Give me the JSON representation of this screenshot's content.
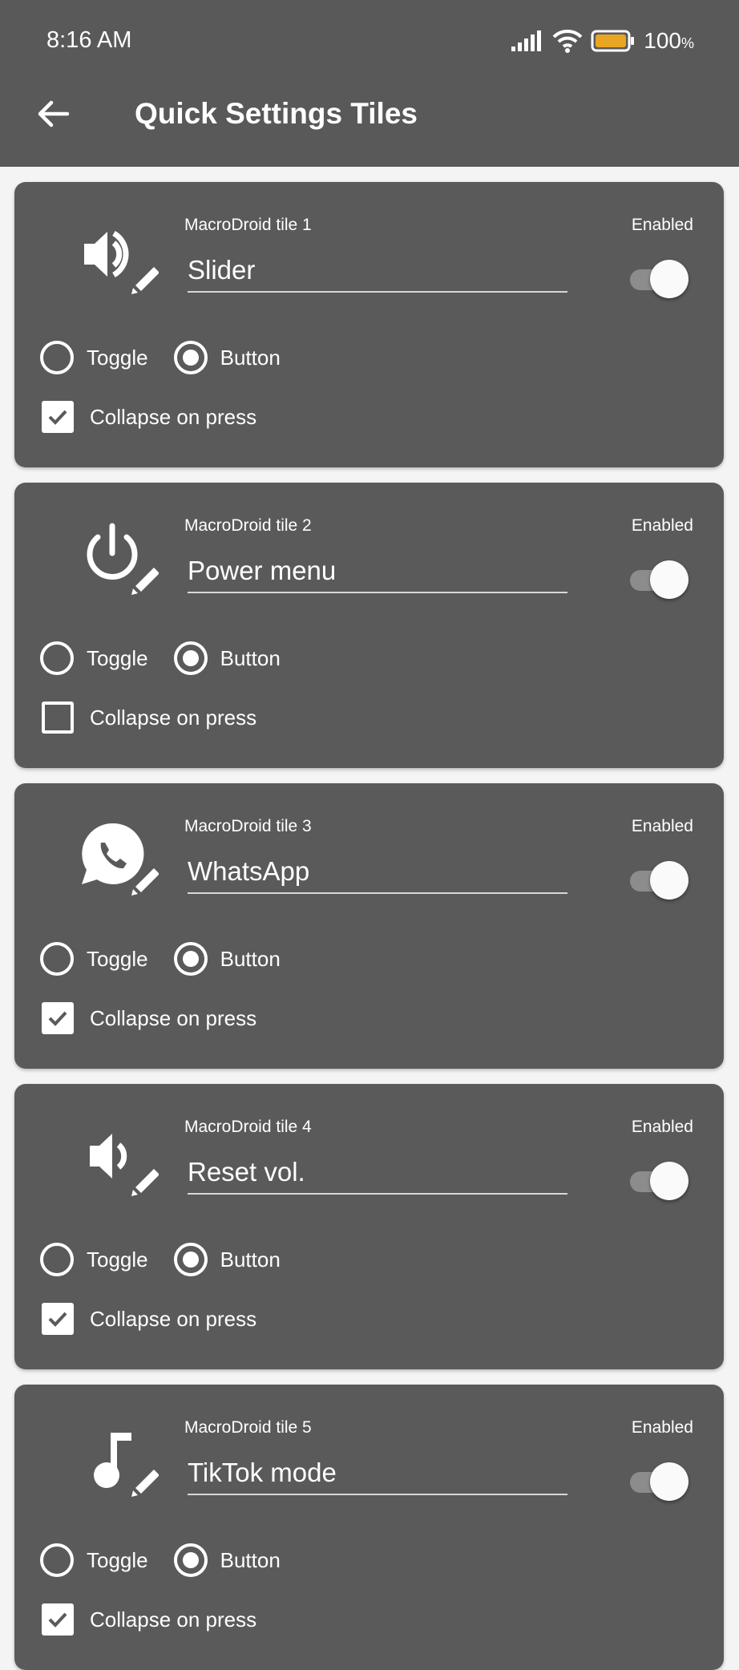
{
  "status_bar": {
    "time": "8:16 AM",
    "battery": "100",
    "battery_unit": "%"
  },
  "app_bar": {
    "title": "Quick Settings Tiles"
  },
  "tiles": [
    {
      "name": "MacroDroid tile 1",
      "label": "Slider",
      "enabled_label": "Enabled",
      "toggle_label": "Toggle",
      "button_label": "Button",
      "collapse_label": "Collapse on press",
      "mode": "button",
      "collapse": true,
      "enabled": true,
      "icon": "volume-up-icon"
    },
    {
      "name": "MacroDroid tile 2",
      "label": "Power menu",
      "enabled_label": "Enabled",
      "toggle_label": "Toggle",
      "button_label": "Button",
      "collapse_label": "Collapse on press",
      "mode": "button",
      "collapse": false,
      "enabled": true,
      "icon": "power-icon"
    },
    {
      "name": "MacroDroid tile 3",
      "label": "WhatsApp",
      "enabled_label": "Enabled",
      "toggle_label": "Toggle",
      "button_label": "Button",
      "collapse_label": "Collapse on press",
      "mode": "button",
      "collapse": true,
      "enabled": true,
      "icon": "whatsapp-icon"
    },
    {
      "name": "MacroDroid tile 4",
      "label": "Reset vol.",
      "enabled_label": "Enabled",
      "toggle_label": "Toggle",
      "button_label": "Button",
      "collapse_label": "Collapse on press",
      "mode": "button",
      "collapse": true,
      "enabled": true,
      "icon": "volume-down-icon"
    },
    {
      "name": "MacroDroid tile 5",
      "label": "TikTok mode",
      "enabled_label": "Enabled",
      "toggle_label": "Toggle",
      "button_label": "Button",
      "collapse_label": "Collapse on press",
      "mode": "button",
      "collapse": true,
      "enabled": true,
      "icon": "music-note-icon"
    }
  ],
  "colors": {
    "app_bar": "#595959",
    "card": "#5a5a5a",
    "background": "#f4f4f4",
    "battery": "#e8a623"
  }
}
